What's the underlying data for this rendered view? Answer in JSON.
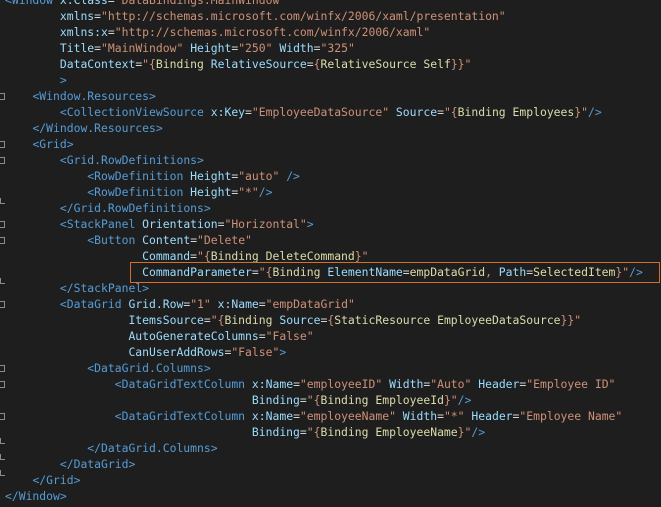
{
  "code_lines": [
    "<Window x:Class=\"DataBindings.MainWindow\"",
    "        xmlns=\"http://schemas.microsoft.com/winfx/2006/xaml/presentation\"",
    "        xmlns:x=\"http://schemas.microsoft.com/winfx/2006/xaml\"",
    "        Title=\"MainWindow\" Height=\"250\" Width=\"325\"",
    "        DataContext=\"{Binding RelativeSource={RelativeSource Self}}\"",
    "        >",
    "    <Window.Resources>",
    "        <CollectionViewSource x:Key=\"EmployeeDataSource\" Source=\"{Binding Employees}\"/>",
    "    </Window.Resources>",
    "    <Grid>",
    "        <Grid.RowDefinitions>",
    "            <RowDefinition Height=\"auto\" />",
    "            <RowDefinition Height=\"*\"/>",
    "        </Grid.RowDefinitions>",
    "        <StackPanel Orientation=\"Horizontal\">",
    "            <Button Content=\"Delete\"",
    "                    Command=\"{Binding DeleteCommand}\"",
    "                    CommandParameter=\"{Binding ElementName=empDataGrid, Path=SelectedItem}\"/>",
    "        </StackPanel>",
    "        <DataGrid Grid.Row=\"1\" x:Name=\"empDataGrid\"",
    "                  ItemsSource=\"{Binding Source={StaticResource EmployeeDataSource}}\"",
    "                  AutoGenerateColumns=\"False\"",
    "                  CanUserAddRows=\"False\">",
    "            <DataGrid.Columns>",
    "                <DataGridTextColumn x:Name=\"employeeID\" Width=\"Auto\" Header=\"Employee ID\"",
    "                                    Binding=\"{Binding EmployeeId}\"/>",
    "                <DataGridTextColumn x:Name=\"employeeName\" Width=\"*\" Header=\"Employee Name\"",
    "                                    Binding=\"{Binding EmployeeName}\"/>",
    "            </DataGrid.Columns>",
    "        </DataGrid>",
    "    </Grid>",
    "</Window>"
  ],
  "highlighted_line": 17
}
